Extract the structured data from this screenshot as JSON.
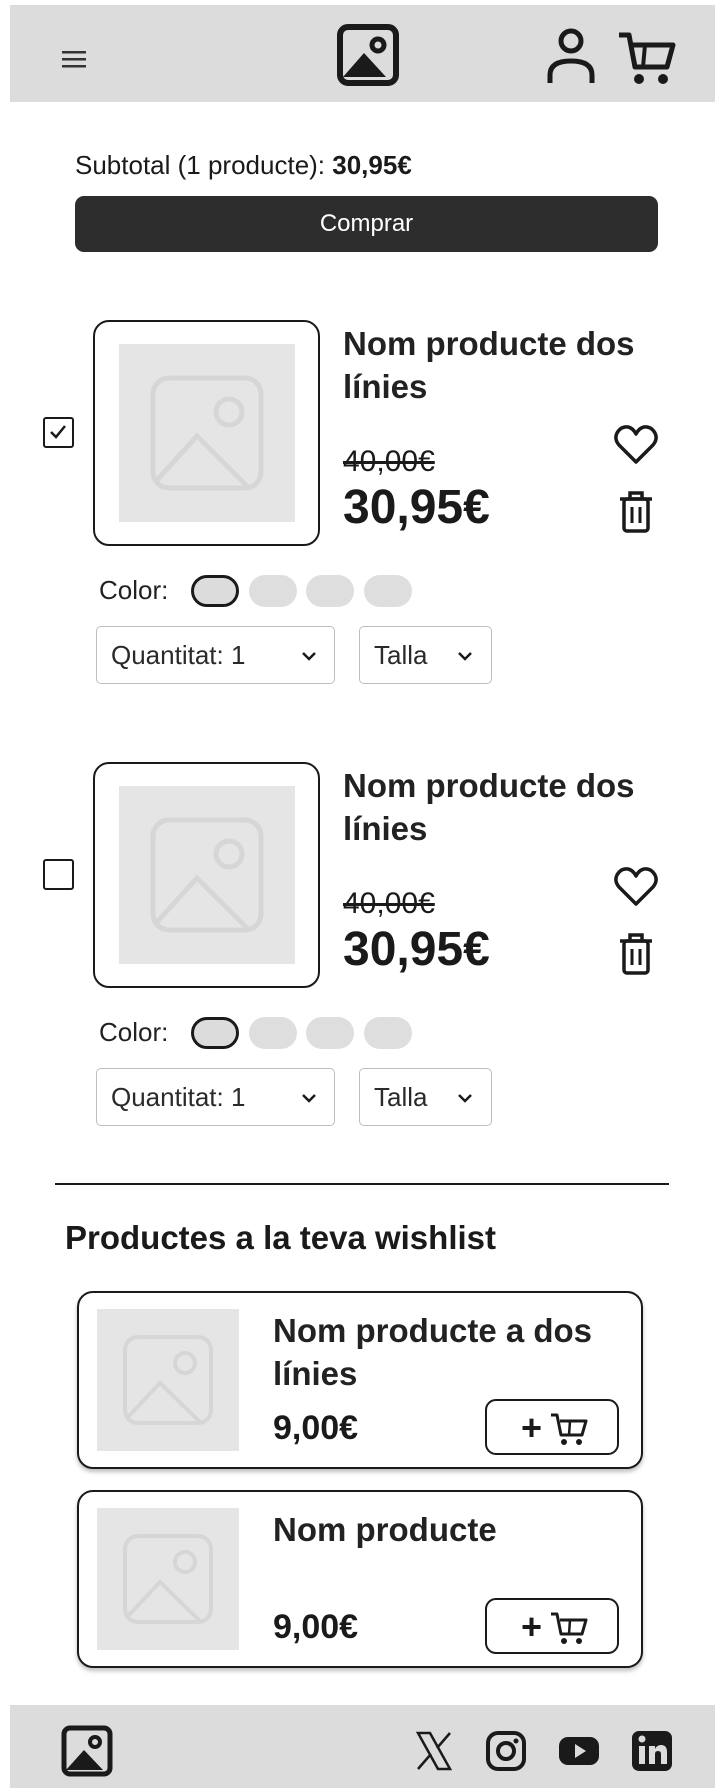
{
  "header": {
    "menu_icon": "hamburger-menu-icon",
    "logo_icon": "image-logo-icon",
    "user_icon": "user-icon",
    "cart_icon": "cart-icon"
  },
  "summary": {
    "subtotal_label": "Subtotal (1 producte): ",
    "subtotal_value": "30,95€",
    "buy_label": "Comprar"
  },
  "cart_items": [
    {
      "checked": true,
      "name": "Nom producte dos línies",
      "old_price": "40,00€",
      "price": "30,95€",
      "color_label": "Color:",
      "quantity_label": "Quantitat: 1",
      "size_label": "Talla"
    },
    {
      "checked": false,
      "name": "Nom producte dos línies",
      "old_price": "40,00€",
      "price": "30,95€",
      "color_label": "Color:",
      "quantity_label": "Quantitat: 1",
      "size_label": "Talla"
    }
  ],
  "wishlist": {
    "title": "Productes a la teva wishlist",
    "items": [
      {
        "name": "Nom producte a dos línies",
        "price": "9,00€",
        "add_label": "+"
      },
      {
        "name": "Nom producte",
        "price": "9,00€",
        "add_label": "+"
      }
    ]
  },
  "footer": {
    "logo_icon": "image-logo-icon",
    "social": [
      "x-icon",
      "instagram-icon",
      "youtube-icon",
      "linkedin-icon"
    ]
  },
  "colors": {
    "header_bg": "#dcdcdc",
    "button_dark": "#2d2d2d",
    "placeholder": "#e5e5e5"
  }
}
